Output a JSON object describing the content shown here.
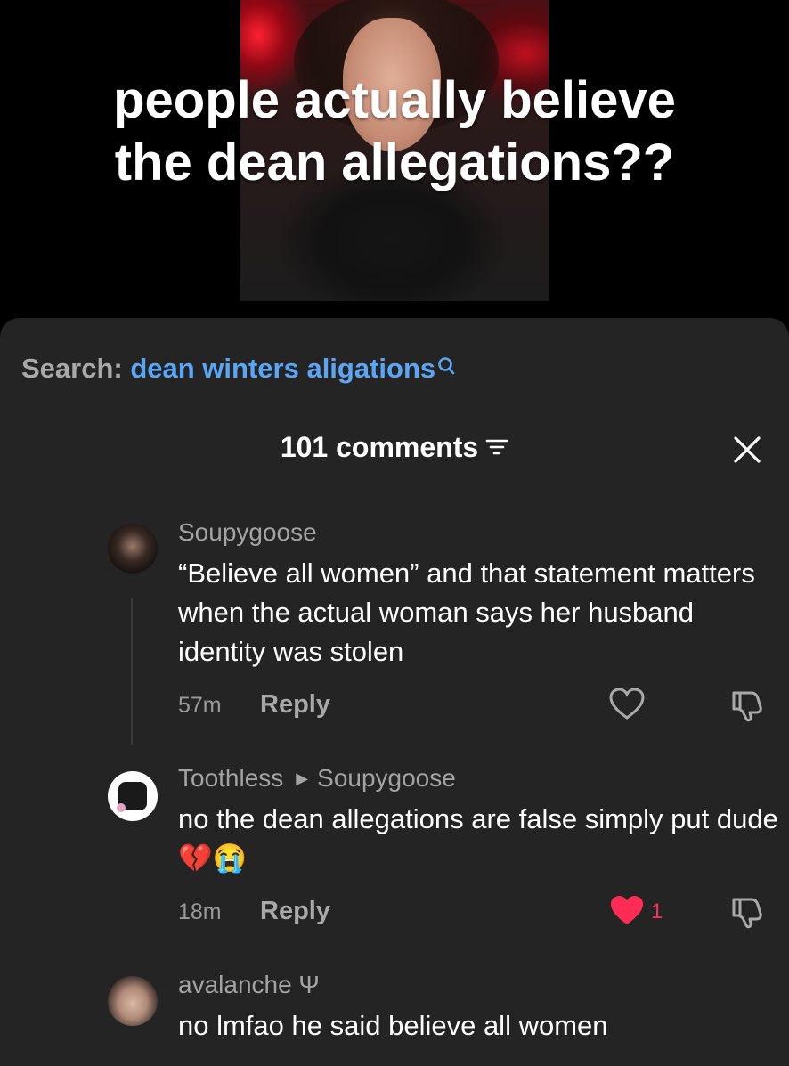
{
  "video": {
    "caption_line1": "people actually believe",
    "caption_line2": "the dean allegations??"
  },
  "search": {
    "label": "Search: ",
    "term": "dean winters aligations"
  },
  "comments_header": {
    "count_label": "101 comments"
  },
  "comments": [
    {
      "username": "Soupygoose",
      "text": "“Believe all women” and that statement matters when the actual woman says her husband identity was stolen",
      "time": "57m",
      "reply_label": "Reply",
      "liked": false
    },
    {
      "username": "Toothless",
      "reply_to": "Soupygoose",
      "text": "no the dean allegations are false simply put dude 💔😭",
      "time": "18m",
      "reply_label": "Reply",
      "liked": true,
      "likes": "1"
    },
    {
      "username": "avalanche Ψ",
      "text": "no lmfao he said believe all women"
    }
  ],
  "colors": {
    "accent_blue": "#5aa6f5",
    "like_red": "#ff2d55",
    "sheet_bg": "#242424"
  }
}
